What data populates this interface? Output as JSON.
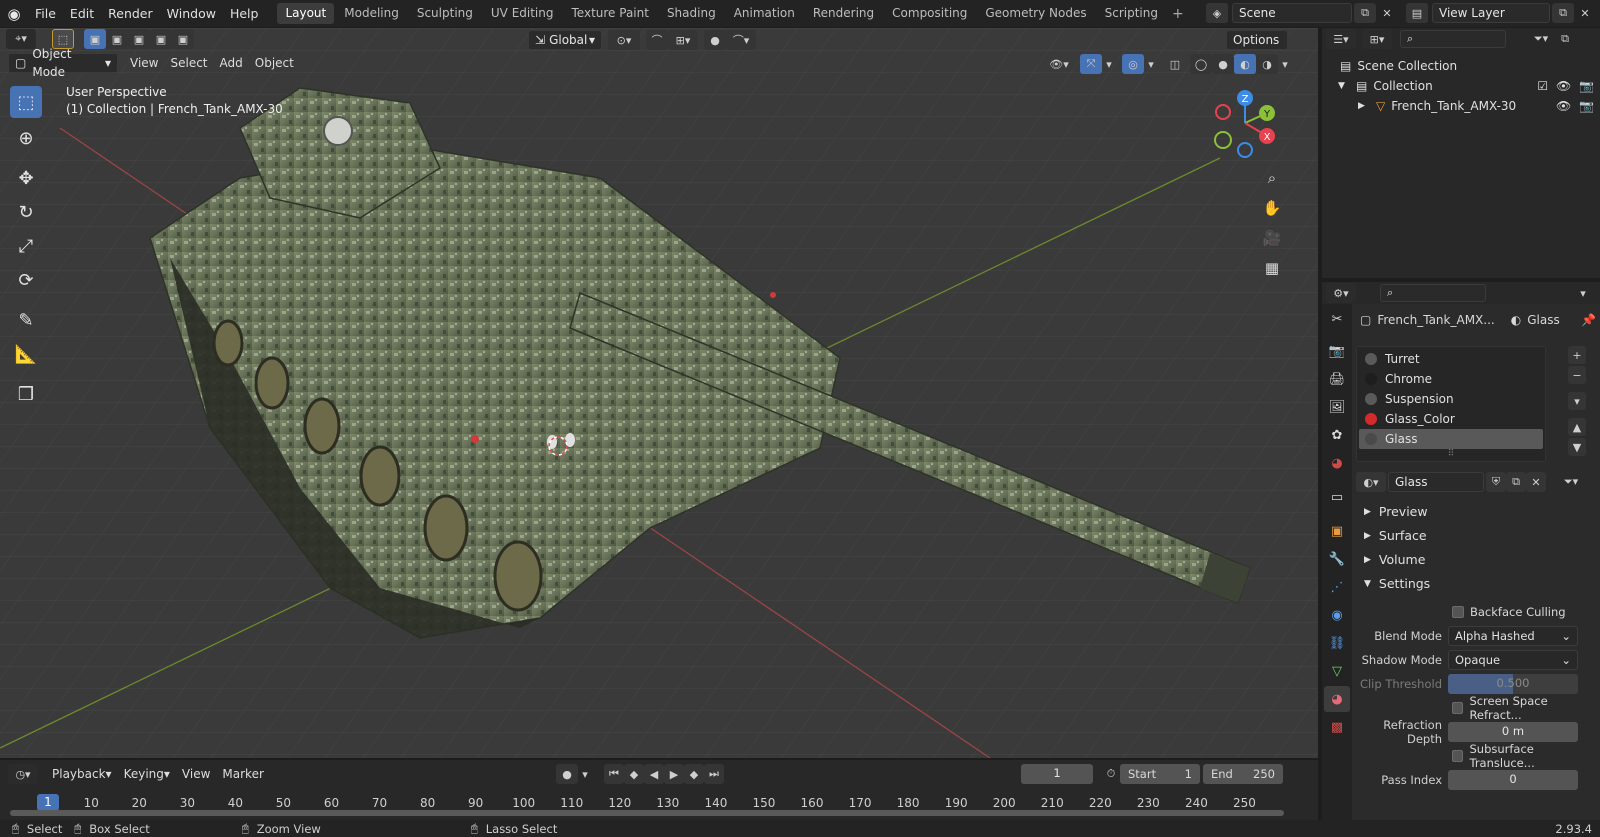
{
  "menu": [
    "File",
    "Edit",
    "Render",
    "Window",
    "Help"
  ],
  "workspaces": [
    "Layout",
    "Modeling",
    "Sculpting",
    "UV Editing",
    "Texture Paint",
    "Shading",
    "Animation",
    "Rendering",
    "Compositing",
    "Geometry Nodes",
    "Scripting"
  ],
  "active_workspace": "Layout",
  "scene_name": "Scene",
  "view_layer": "View Layer",
  "viewport": {
    "transform_orientation": "Global",
    "options_label": "Options",
    "mode": "Object Mode",
    "header_menus": [
      "View",
      "Select",
      "Add",
      "Object"
    ],
    "overlay_line1": "User Perspective",
    "overlay_line2": "(1) Collection | French_Tank_AMX-30",
    "gizmo_axes": {
      "x": "X",
      "y": "Y",
      "z": "Z"
    },
    "colors": {
      "x": "#e8414f",
      "y": "#8ac136",
      "z": "#3d8ce8",
      "grid_x_line": "#9c4545",
      "grid_y_line": "#6d8a2c"
    }
  },
  "outliner": {
    "root": "Scene Collection",
    "collection": "Collection",
    "object": "French_Tank_AMX-30"
  },
  "properties": {
    "object_name": "French_Tank_AMX...",
    "material_name": "Glass",
    "slots": [
      {
        "name": "Turret",
        "color": "#5a5a5a"
      },
      {
        "name": "Chrome",
        "color": "#1e1e1e"
      },
      {
        "name": "Suspension",
        "color": "#5a5a5a"
      },
      {
        "name": "Glass_Color",
        "color": "#d42a2a"
      },
      {
        "name": "Glass",
        "color": "#4a4a4a"
      }
    ],
    "active_slot": "Glass",
    "datablock_name": "Glass",
    "panels": {
      "preview": "Preview",
      "surface": "Surface",
      "volume": "Volume",
      "settings": "Settings"
    },
    "settings": {
      "backface_culling": "Backface Culling",
      "blend_mode_label": "Blend Mode",
      "blend_mode": "Alpha Hashed",
      "shadow_mode_label": "Shadow Mode",
      "shadow_mode": "Opaque",
      "clip_threshold_label": "Clip Threshold",
      "clip_threshold": "0.500",
      "ssr": "Screen Space Refract...",
      "refraction_depth_label": "Refraction Depth",
      "refraction_depth": "0 m",
      "sss": "Subsurface Translucе...",
      "pass_index_label": "Pass Index",
      "pass_index": "0"
    }
  },
  "timeline": {
    "menus": [
      "Playback",
      "Keying",
      "View",
      "Marker"
    ],
    "current_frame": "1",
    "start_label": "Start",
    "start": "1",
    "end_label": "End",
    "end": "250",
    "ruler_ticks": [
      "10",
      "20",
      "30",
      "40",
      "50",
      "60",
      "70",
      "80",
      "90",
      "100",
      "110",
      "120",
      "130",
      "140",
      "150",
      "160",
      "170",
      "180",
      "190",
      "200",
      "210",
      "220",
      "230",
      "240",
      "250"
    ],
    "playhead": "1"
  },
  "status": {
    "select": "Select",
    "box_select": "Box Select",
    "zoom_view": "Zoom View",
    "lasso_select": "Lasso Select",
    "version": "2.93.4"
  }
}
